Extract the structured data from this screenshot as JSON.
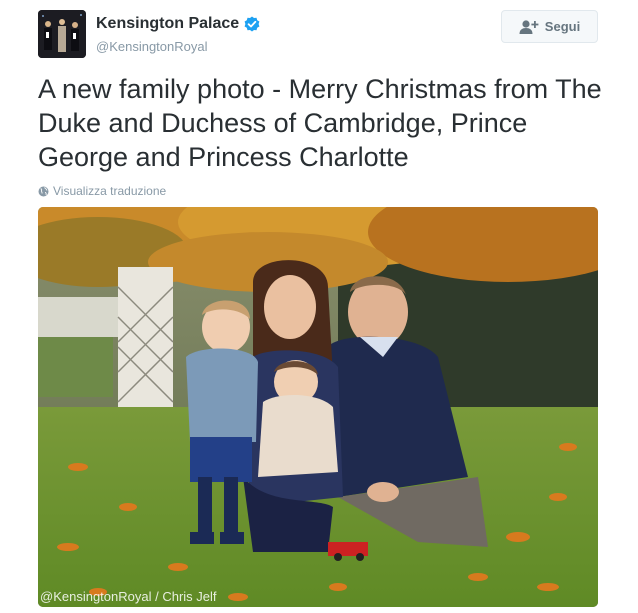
{
  "account": {
    "display_name": "Kensington Palace",
    "handle": "@KensingtonRoyal",
    "verified_icon": "verified-badge-icon"
  },
  "follow_button": {
    "label": "Segui",
    "icon": "add-user-icon"
  },
  "tweet": {
    "text": "A new family photo - Merry Christmas from The Duke and Duchess of Cambridge, Prince George and Princess Charlotte"
  },
  "translate": {
    "label": "Visualizza traduzione",
    "icon": "globe-icon"
  },
  "photo": {
    "watermark": "@KensingtonRoyal / Chris Jelf"
  },
  "colors": {
    "verified_blue": "#1da1f2",
    "text": "#292f33",
    "muted": "#8899a6"
  }
}
